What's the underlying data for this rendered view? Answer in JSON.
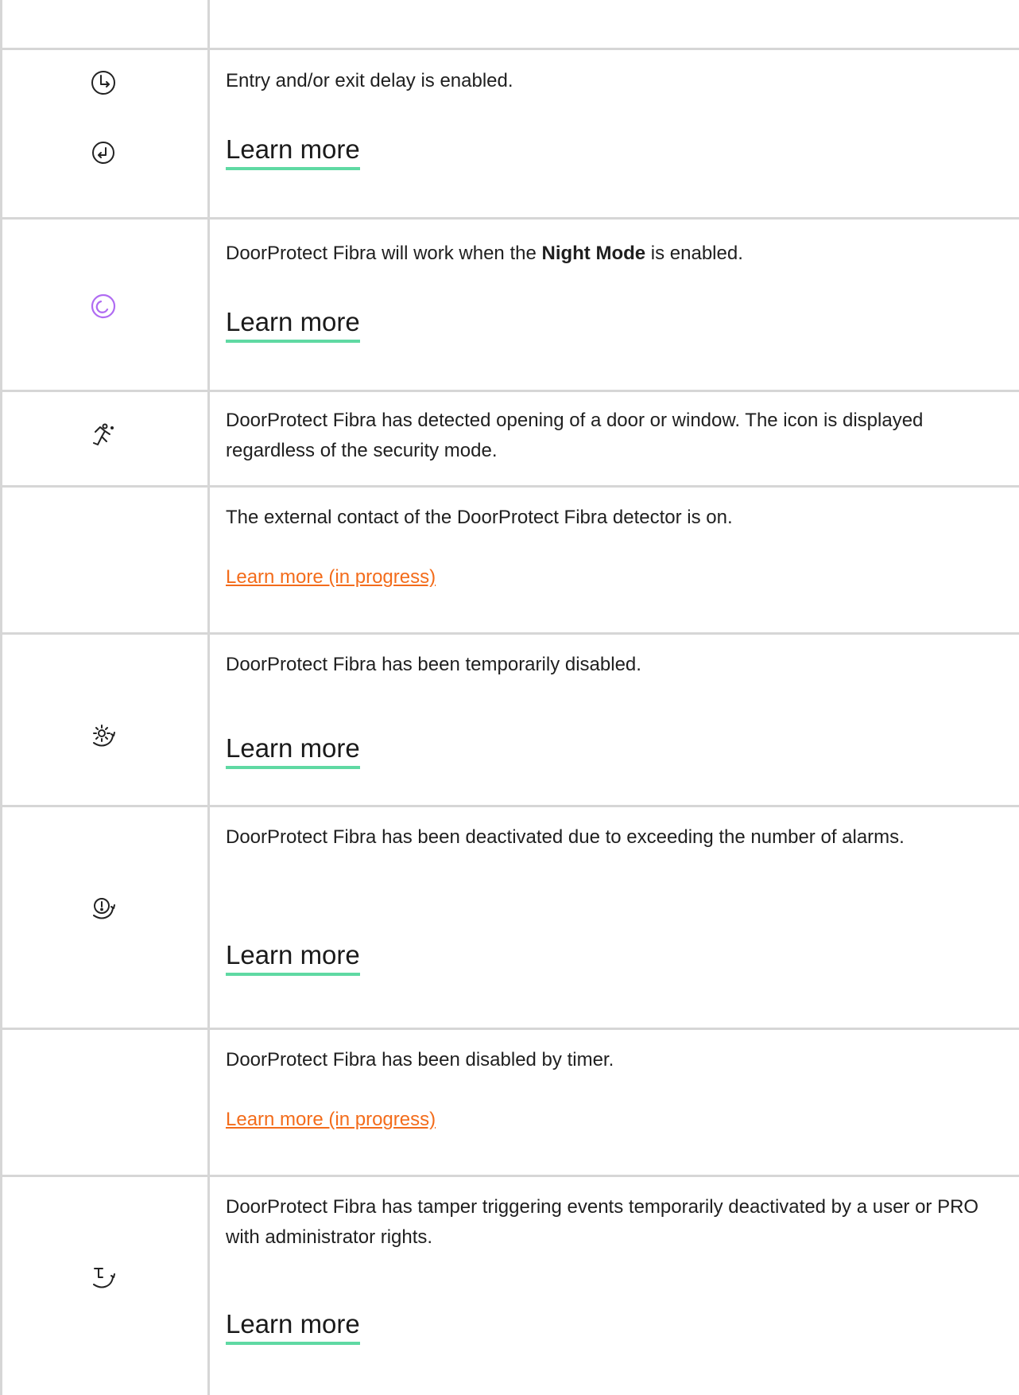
{
  "rows": [
    {
      "description": "Entry and/or exit delay is enabled.",
      "link": "Learn more",
      "icons": [
        "clock-entry-delay-icon",
        "clock-exit-delay-icon"
      ]
    },
    {
      "description_before": "DoorProtect Fibra will work when the ",
      "description_bold": "Night Mode",
      "description_after": " is enabled.",
      "link": "Learn more",
      "icons": [
        "night-mode-icon"
      ],
      "icon_color": "#b06cf2"
    },
    {
      "description": "DoorProtect Fibra has detected opening of a door or window. The icon is displayed regardless of the security mode.",
      "icons": [
        "running-person-icon"
      ]
    },
    {
      "description": "The external contact of the DoorProtect Fibra detector is on.",
      "link": "Learn more (in progress)"
    },
    {
      "description": "DoorProtect Fibra has been temporarily disabled.",
      "link": "Learn more",
      "icons": [
        "gear-deactivated-icon"
      ]
    },
    {
      "description": "DoorProtect Fibra has been deactivated due to exceeding the number of alarms.",
      "link": "Learn more",
      "icons": [
        "alert-deactivated-icon"
      ]
    },
    {
      "description": "DoorProtect Fibra has been disabled by timer.",
      "link": "Learn more (in progress)"
    },
    {
      "description": "DoorProtect Fibra has tamper triggering events temporarily deactivated by a user or PRO with administrator rights.",
      "link": "Learn more",
      "icons": [
        "tamper-deactivated-icon"
      ]
    }
  ],
  "colors": {
    "grid_line": "#d6d6d6",
    "link_underline": "#5fd9a3",
    "in_progress_link": "#f36c1b",
    "night_mode_icon": "#b06cf2",
    "text": "#1f1f1f"
  }
}
